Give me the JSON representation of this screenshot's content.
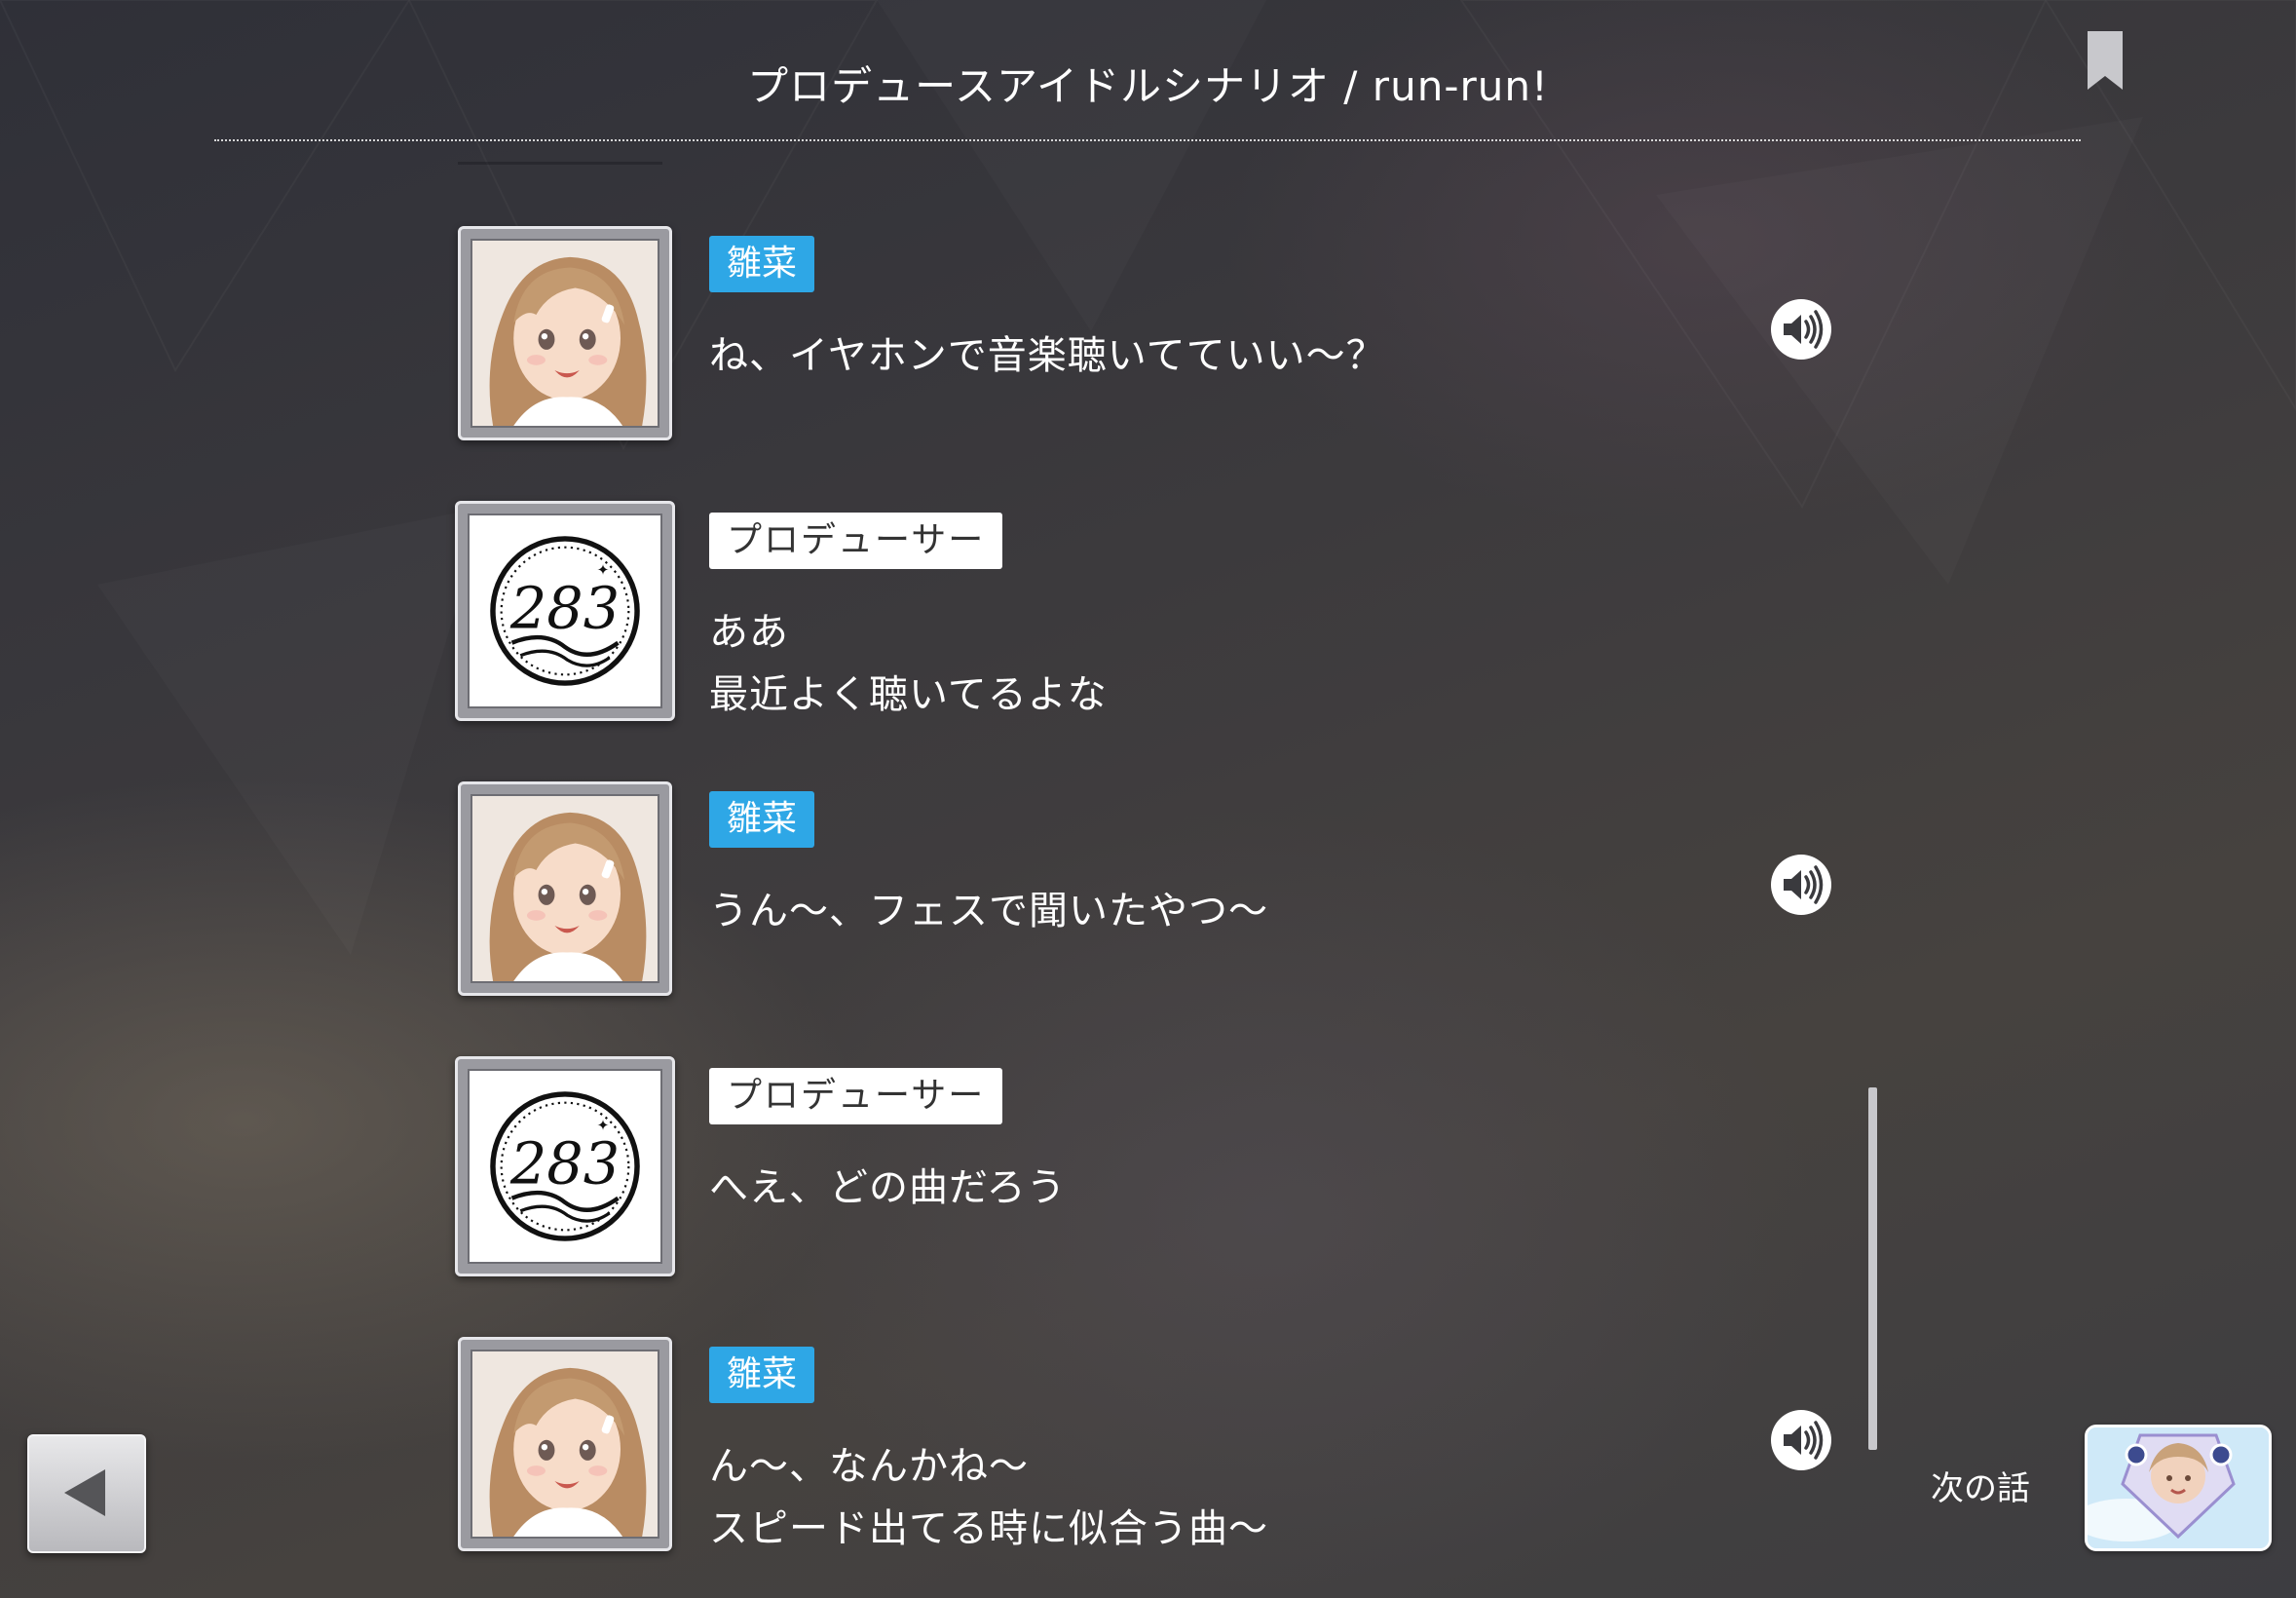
{
  "header": {
    "title": "プロデュースアイドルシナリオ / run-run!"
  },
  "dialogue": [
    {
      "speaker": "雛菜",
      "lines": [
        "ね、イヤホンで音楽聴いてていい～？"
      ],
      "has_voice": true
    },
    {
      "speaker": "プロデューサー",
      "lines": [
        "ああ",
        "最近よく聴いてるよな"
      ],
      "has_voice": false
    },
    {
      "speaker": "雛菜",
      "lines": [
        "うん～、フェスで聞いたやつ～"
      ],
      "has_voice": true
    },
    {
      "speaker": "プロデューサー",
      "lines": [
        "へえ、どの曲だろう"
      ],
      "has_voice": false
    },
    {
      "speaker": "雛菜",
      "lines": [
        "ん～、なんかね～",
        "スピード出てる時に似合う曲～"
      ],
      "has_voice": true
    }
  ],
  "producer_logo_text": "283",
  "footer": {
    "next_label": "次の話"
  },
  "icons": {
    "bookmark": "bookmark-icon",
    "voice": "speaker-icon",
    "back": "back-arrow-icon"
  },
  "colors": {
    "hina_badge": "#2ea7e6",
    "producer_badge": "#ffffff"
  }
}
